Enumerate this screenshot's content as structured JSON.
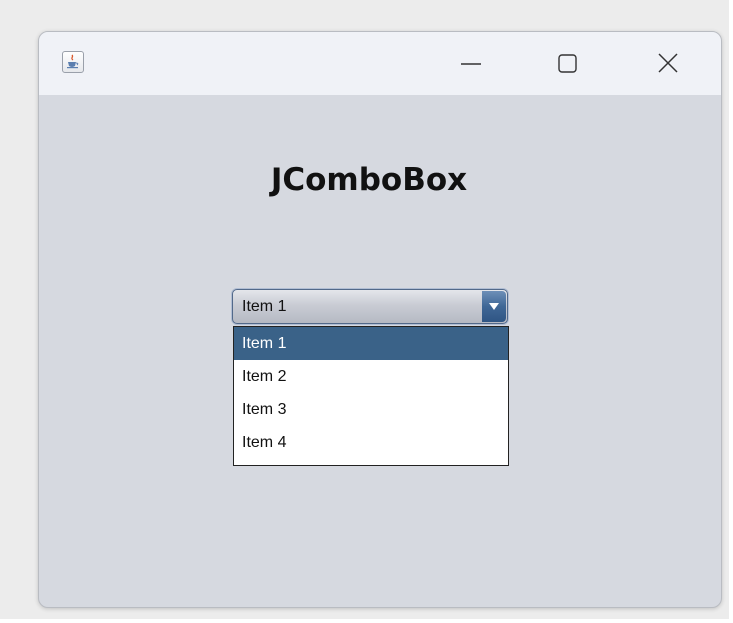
{
  "window": {
    "app_icon": "java-cup-icon",
    "controls": {
      "minimize_icon": "minimize-icon",
      "maximize_icon": "maximize-icon",
      "close_icon": "close-icon"
    }
  },
  "main": {
    "heading": "JComboBox",
    "combo": {
      "selected_value": "Item 1",
      "arrow_icon": "chevron-down-icon",
      "options": [
        "Item 1",
        "Item 2",
        "Item 3",
        "Item 4"
      ],
      "highlighted_index": 0
    }
  },
  "colors": {
    "window_bg": "#d6d9e0",
    "titlebar_bg": "#f0f2f7",
    "selection_bg": "#3a6288",
    "selection_fg": "#ffffff"
  }
}
